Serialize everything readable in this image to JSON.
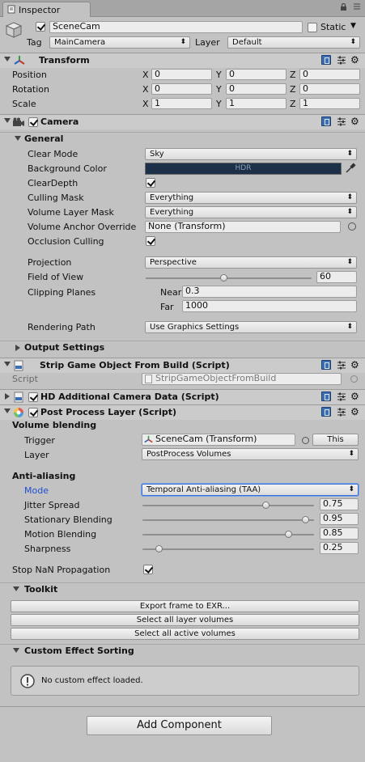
{
  "tab": {
    "title": "Inspector"
  },
  "gameobject": {
    "name": "SceneCam",
    "static_label": "Static",
    "tag_label": "Tag",
    "tag_value": "MainCamera",
    "layer_label": "Layer",
    "layer_value": "Default"
  },
  "transform": {
    "title": "Transform",
    "rows": [
      {
        "label": "Position",
        "x": "0",
        "y": "0",
        "z": "0"
      },
      {
        "label": "Rotation",
        "x": "0",
        "y": "0",
        "z": "0"
      },
      {
        "label": "Scale",
        "x": "1",
        "y": "1",
        "z": "1"
      }
    ],
    "axis": {
      "x": "X",
      "y": "Y",
      "z": "Z"
    }
  },
  "camera": {
    "title": "Camera",
    "general_title": "General",
    "clear_mode_label": "Clear Mode",
    "clear_mode_value": "Sky",
    "bg_color_label": "Background Color",
    "bg_color_text": "HDR",
    "bg_color": "#1c3148",
    "clear_depth_label": "ClearDepth",
    "culling_mask_label": "Culling Mask",
    "culling_mask_value": "Everything",
    "volume_layer_mask_label": "Volume Layer Mask",
    "volume_layer_mask_value": "Everything",
    "volume_anchor_label": "Volume Anchor Override",
    "volume_anchor_value": "None (Transform)",
    "occlusion_label": "Occlusion Culling",
    "projection_label": "Projection",
    "projection_value": "Perspective",
    "fov_label": "Field of View",
    "fov_value": "60",
    "clipping_label": "Clipping Planes",
    "near_label": "Near",
    "near_value": "0.3",
    "far_label": "Far",
    "far_value": "1000",
    "rendering_path_label": "Rendering Path",
    "rendering_path_value": "Use Graphics Settings",
    "output_settings_title": "Output Settings"
  },
  "strip": {
    "title": "Strip Game Object From Build (Script)",
    "script_label": "Script",
    "script_value": "StripGameObjectFromBuild"
  },
  "hdcam": {
    "title": "HD Additional Camera Data (Script)"
  },
  "ppl": {
    "title": "Post Process Layer (Script)",
    "volume_blending_title": "Volume blending",
    "trigger_label": "Trigger",
    "trigger_value": "SceneCam (Transform)",
    "this_button": "This",
    "layer_label": "Layer",
    "layer_value": "PostProcess Volumes",
    "aa_title": "Anti-aliasing",
    "mode_label": "Mode",
    "mode_value": "Temporal Anti-aliasing (TAA)",
    "jitter_label": "Jitter Spread",
    "jitter_value": "0.75",
    "stationary_label": "Stationary Blending",
    "stationary_value": "0.95",
    "motion_label": "Motion Blending",
    "motion_value": "0.85",
    "sharpness_label": "Sharpness",
    "sharpness_value": "0.25",
    "nan_label": "Stop NaN Propagation",
    "toolkit_title": "Toolkit",
    "export_button": "Export frame to EXR...",
    "select_layer_button": "Select all layer volumes",
    "select_active_button": "Select all active volumes",
    "custom_sorting_title": "Custom Effect Sorting",
    "no_custom_text": "No custom effect loaded."
  },
  "add_component": "Add Component",
  "colors": {
    "mode_label": "#1f4fd1",
    "accent": "#3b6fb5"
  }
}
